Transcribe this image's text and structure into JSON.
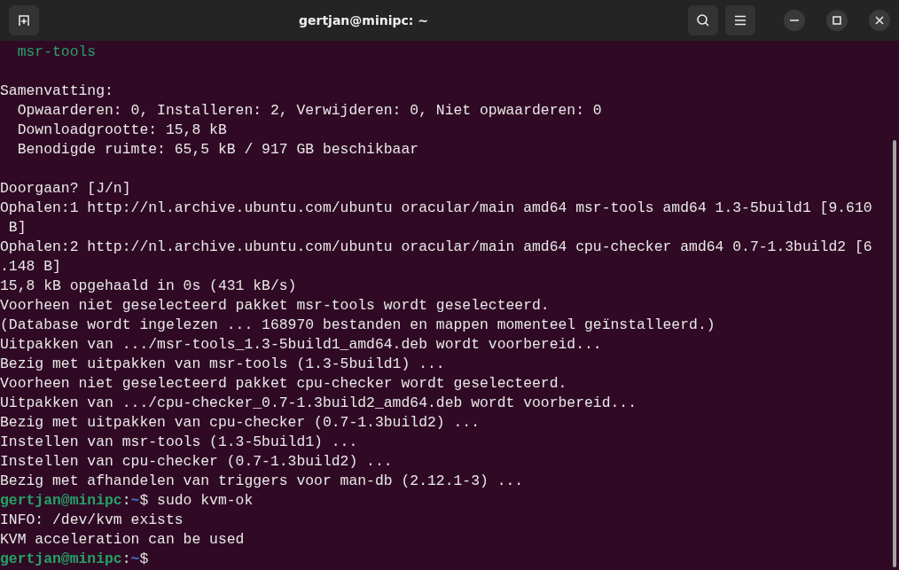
{
  "window": {
    "title": "gertjan@minipc: ~"
  },
  "terminal": {
    "lines": [
      {
        "kind": "package",
        "text": "  msr-tools"
      },
      {
        "kind": "blank"
      },
      {
        "kind": "text",
        "text": "Samenvatting:"
      },
      {
        "kind": "text",
        "text": "  Opwaarderen: 0, Installeren: 2, Verwijderen: 0, Niet opwaarderen: 0"
      },
      {
        "kind": "text",
        "text": "  Downloadgrootte: 15,8 kB"
      },
      {
        "kind": "text",
        "text": "  Benodigde ruimte: 65,5 kB / 917 GB beschikbaar"
      },
      {
        "kind": "blank"
      },
      {
        "kind": "text",
        "text": "Doorgaan? [J/n]"
      },
      {
        "kind": "text",
        "text": "Ophalen:1 http://nl.archive.ubuntu.com/ubuntu oracular/main amd64 msr-tools amd64 1.3-5build1 [9.610"
      },
      {
        "kind": "text",
        "text": " B]"
      },
      {
        "kind": "text",
        "text": "Ophalen:2 http://nl.archive.ubuntu.com/ubuntu oracular/main amd64 cpu-checker amd64 0.7-1.3build2 [6"
      },
      {
        "kind": "text",
        "text": ".148 B]"
      },
      {
        "kind": "text",
        "text": "15,8 kB opgehaald in 0s (431 kB/s)"
      },
      {
        "kind": "text",
        "text": "Voorheen niet geselecteerd pakket msr-tools wordt geselecteerd."
      },
      {
        "kind": "text",
        "text": "(Database wordt ingelezen ... 168970 bestanden en mappen momenteel geïnstalleerd.)"
      },
      {
        "kind": "text",
        "text": "Uitpakken van .../msr-tools_1.3-5build1_amd64.deb wordt voorbereid..."
      },
      {
        "kind": "text",
        "text": "Bezig met uitpakken van msr-tools (1.3-5build1) ..."
      },
      {
        "kind": "text",
        "text": "Voorheen niet geselecteerd pakket cpu-checker wordt geselecteerd."
      },
      {
        "kind": "text",
        "text": "Uitpakken van .../cpu-checker_0.7-1.3build2_amd64.deb wordt voorbereid..."
      },
      {
        "kind": "text",
        "text": "Bezig met uitpakken van cpu-checker (0.7-1.3build2) ..."
      },
      {
        "kind": "text",
        "text": "Instellen van msr-tools (1.3-5build1) ..."
      },
      {
        "kind": "text",
        "text": "Instellen van cpu-checker (0.7-1.3build2) ..."
      },
      {
        "kind": "text",
        "text": "Bezig met afhandelen van triggers voor man-db (2.12.1-3) ..."
      },
      {
        "kind": "prompt",
        "user_host": "gertjan@minipc",
        "separator": ":",
        "path": "~",
        "symbol": "$",
        "command": "sudo kvm-ok"
      },
      {
        "kind": "text",
        "text": "INFO: /dev/kvm exists"
      },
      {
        "kind": "text",
        "text": "KVM acceleration can be used"
      },
      {
        "kind": "prompt",
        "user_host": "gertjan@minipc",
        "separator": ":",
        "path": "~",
        "symbol": "$"
      }
    ]
  }
}
